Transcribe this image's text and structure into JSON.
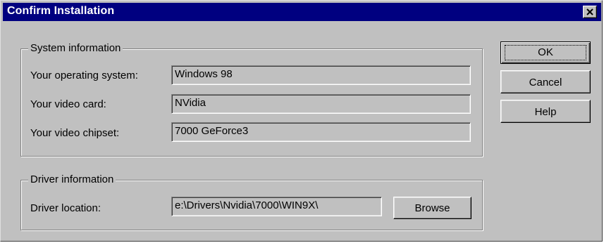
{
  "window": {
    "title": "Confirm Installation",
    "close_symbol": "close-icon"
  },
  "system_info": {
    "legend": "System information",
    "os_label": "Your operating system:",
    "os_value": "Windows 98",
    "video_card_label": "Your video card:",
    "video_card_value": "NVidia",
    "chipset_label": "Your video chipset:",
    "chipset_value": "7000 GeForce3"
  },
  "driver_info": {
    "legend": "Driver information",
    "location_label": "Driver location:",
    "location_value": "e:\\Drivers\\Nvidia\\7000\\WIN9X\\",
    "browse_label": "Browse"
  },
  "buttons": {
    "ok_label": "OK",
    "cancel_label": "Cancel",
    "help_label": "Help"
  },
  "colors": {
    "titlebar": "#000080",
    "face": "#c0c0c0"
  }
}
